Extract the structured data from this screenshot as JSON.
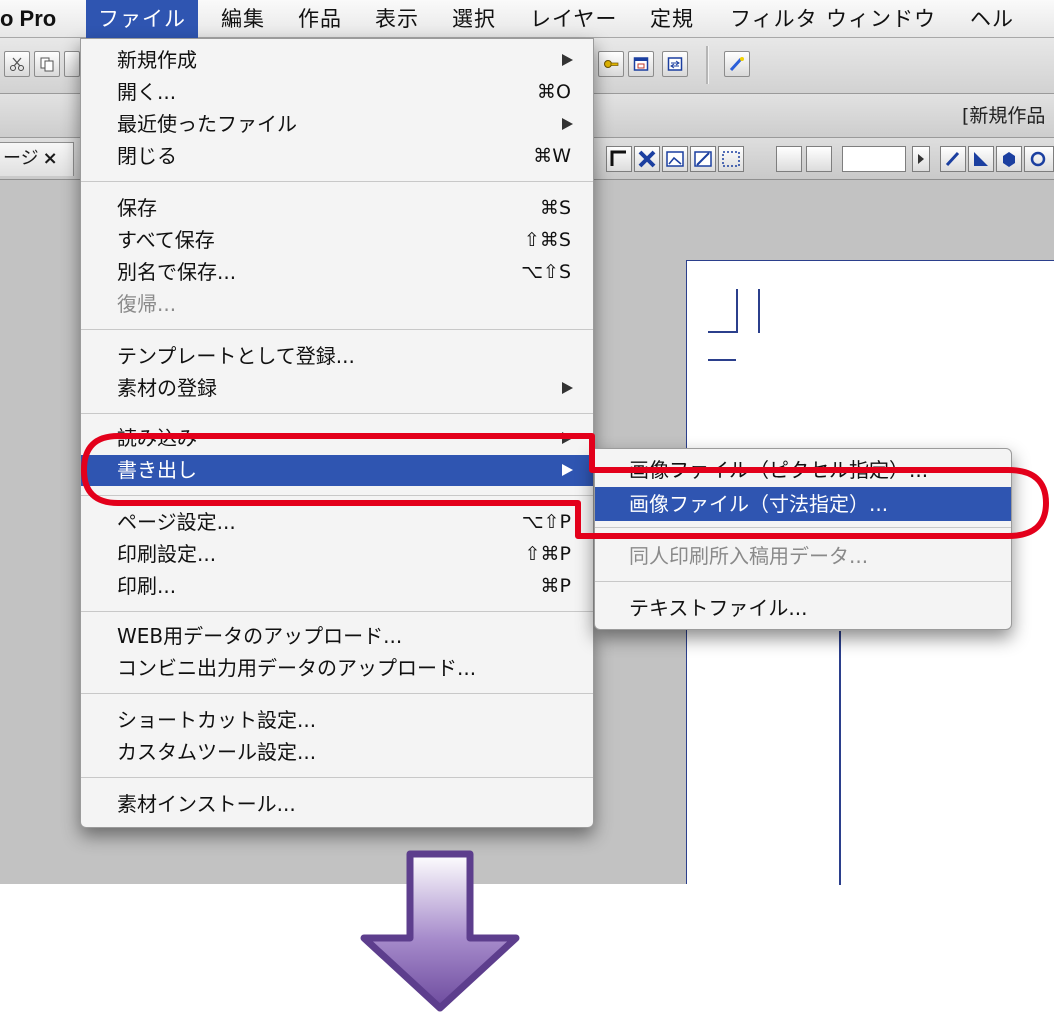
{
  "menubar": {
    "app_name": "o Pro",
    "items": [
      "ファイル",
      "編集",
      "作品",
      "表示",
      "選択",
      "レイヤー",
      "定規",
      "フィルタ",
      "ウィンドウ",
      "ヘル"
    ]
  },
  "window": {
    "title": "[新規作品"
  },
  "doc_tab": {
    "label": "ージ",
    "close": "×"
  },
  "file_menu": {
    "items": [
      {
        "label": "新規作成",
        "submenu": true
      },
      {
        "label": "開く...",
        "shortcut": "⌘O"
      },
      {
        "label": "最近使ったファイル",
        "submenu": true
      },
      {
        "label": "閉じる",
        "shortcut": "⌘W"
      },
      {
        "label": "保存",
        "shortcut": "⌘S"
      },
      {
        "label": "すべて保存",
        "shortcut": "⇧⌘S"
      },
      {
        "label": "別名で保存...",
        "shortcut": "⌥⇧S"
      },
      {
        "label": "復帰...",
        "disabled": true
      },
      {
        "label": "テンプレートとして登録..."
      },
      {
        "label": "素材の登録",
        "submenu": true
      },
      {
        "label": "読み込み",
        "submenu": true
      },
      {
        "label": "書き出し",
        "submenu": true,
        "highlighted": true
      },
      {
        "label": "ページ設定...",
        "shortcut": "⌥⇧P"
      },
      {
        "label": "印刷設定...",
        "shortcut": "⇧⌘P"
      },
      {
        "label": "印刷...",
        "shortcut": "⌘P"
      },
      {
        "label": "WEB用データのアップロード..."
      },
      {
        "label": "コンビニ出力用データのアップロード..."
      },
      {
        "label": "ショートカット設定..."
      },
      {
        "label": "カスタムツール設定..."
      },
      {
        "label": "素材インストール..."
      }
    ]
  },
  "export_submenu": {
    "items": [
      {
        "label": "画像ファイル（ピクセル指定）..."
      },
      {
        "label": "画像ファイル（寸法指定）...",
        "highlighted": true
      },
      {
        "label": "同人印刷所入稿用データ...",
        "disabled": true
      },
      {
        "label": "テキストファイル..."
      }
    ]
  },
  "colors": {
    "highlight": "#2f55b1",
    "annotation_red": "#e3001b",
    "arrow_purple": "#7a5aa8"
  },
  "icons": [
    "scissors-icon",
    "copy-icon",
    "paste-icon",
    "key-icon",
    "window-icon",
    "refresh-icon",
    "magic-icon"
  ]
}
